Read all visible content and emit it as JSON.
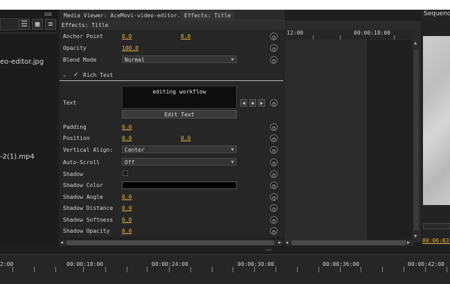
{
  "left_panel": {
    "items": [
      {
        "label": "eo-editor.jpg"
      },
      {
        "label": "-2(1).mp4"
      }
    ]
  },
  "tabs": [
    {
      "label": "Media Viewer: AceMovi-video-editor.jpg"
    },
    {
      "label": "Effects: Title"
    }
  ],
  "effects": {
    "header": "Effects: Title",
    "rows": {
      "anchor_point": {
        "label": "Anchor Point",
        "x": "0.0",
        "y": "0.0"
      },
      "opacity": {
        "label": "Opacity",
        "value": "100.0"
      },
      "blend_mode": {
        "label": "Blend Mode",
        "value": "Normal"
      },
      "rich_text": {
        "label": "Rich Text"
      },
      "text": {
        "label": "Text",
        "content": "editing workflow",
        "edit_button": "Edit Text"
      },
      "padding": {
        "label": "Padding",
        "value": "0.0"
      },
      "position": {
        "label": "Position",
        "x": "0.0",
        "y": "0.0"
      },
      "vertical_align": {
        "label": "Vertical Align:",
        "value": "Center"
      },
      "auto_scroll": {
        "label": "Auto-Scroll",
        "value": "Off"
      },
      "shadow": {
        "label": "Shadow"
      },
      "shadow_color": {
        "label": "Shadow Color",
        "color": "#000000"
      },
      "shadow_angle": {
        "label": "Shadow Angle",
        "value": "0.0"
      },
      "shadow_distance": {
        "label": "Shadow Distance",
        "value": "0.0"
      },
      "shadow_softness": {
        "label": "Shadow Softness",
        "value": "0.0"
      },
      "shadow_opacity": {
        "label": "Shadow Opacity",
        "value": "0.0"
      }
    }
  },
  "keyframe_timeline": {
    "labels": [
      "12:00",
      "00:00:18:00"
    ]
  },
  "sequence": {
    "title": "Sequence",
    "timecode": "00:00:03:0"
  },
  "bottom_timeline": {
    "labels": [
      "2:00",
      "00:00:18:00",
      "00:00:24:00",
      "00:00:30:00",
      "00:00:36:00",
      "00:00:42:00"
    ]
  },
  "colors": {
    "accent": "#e6b43a",
    "panel": "#262626"
  }
}
